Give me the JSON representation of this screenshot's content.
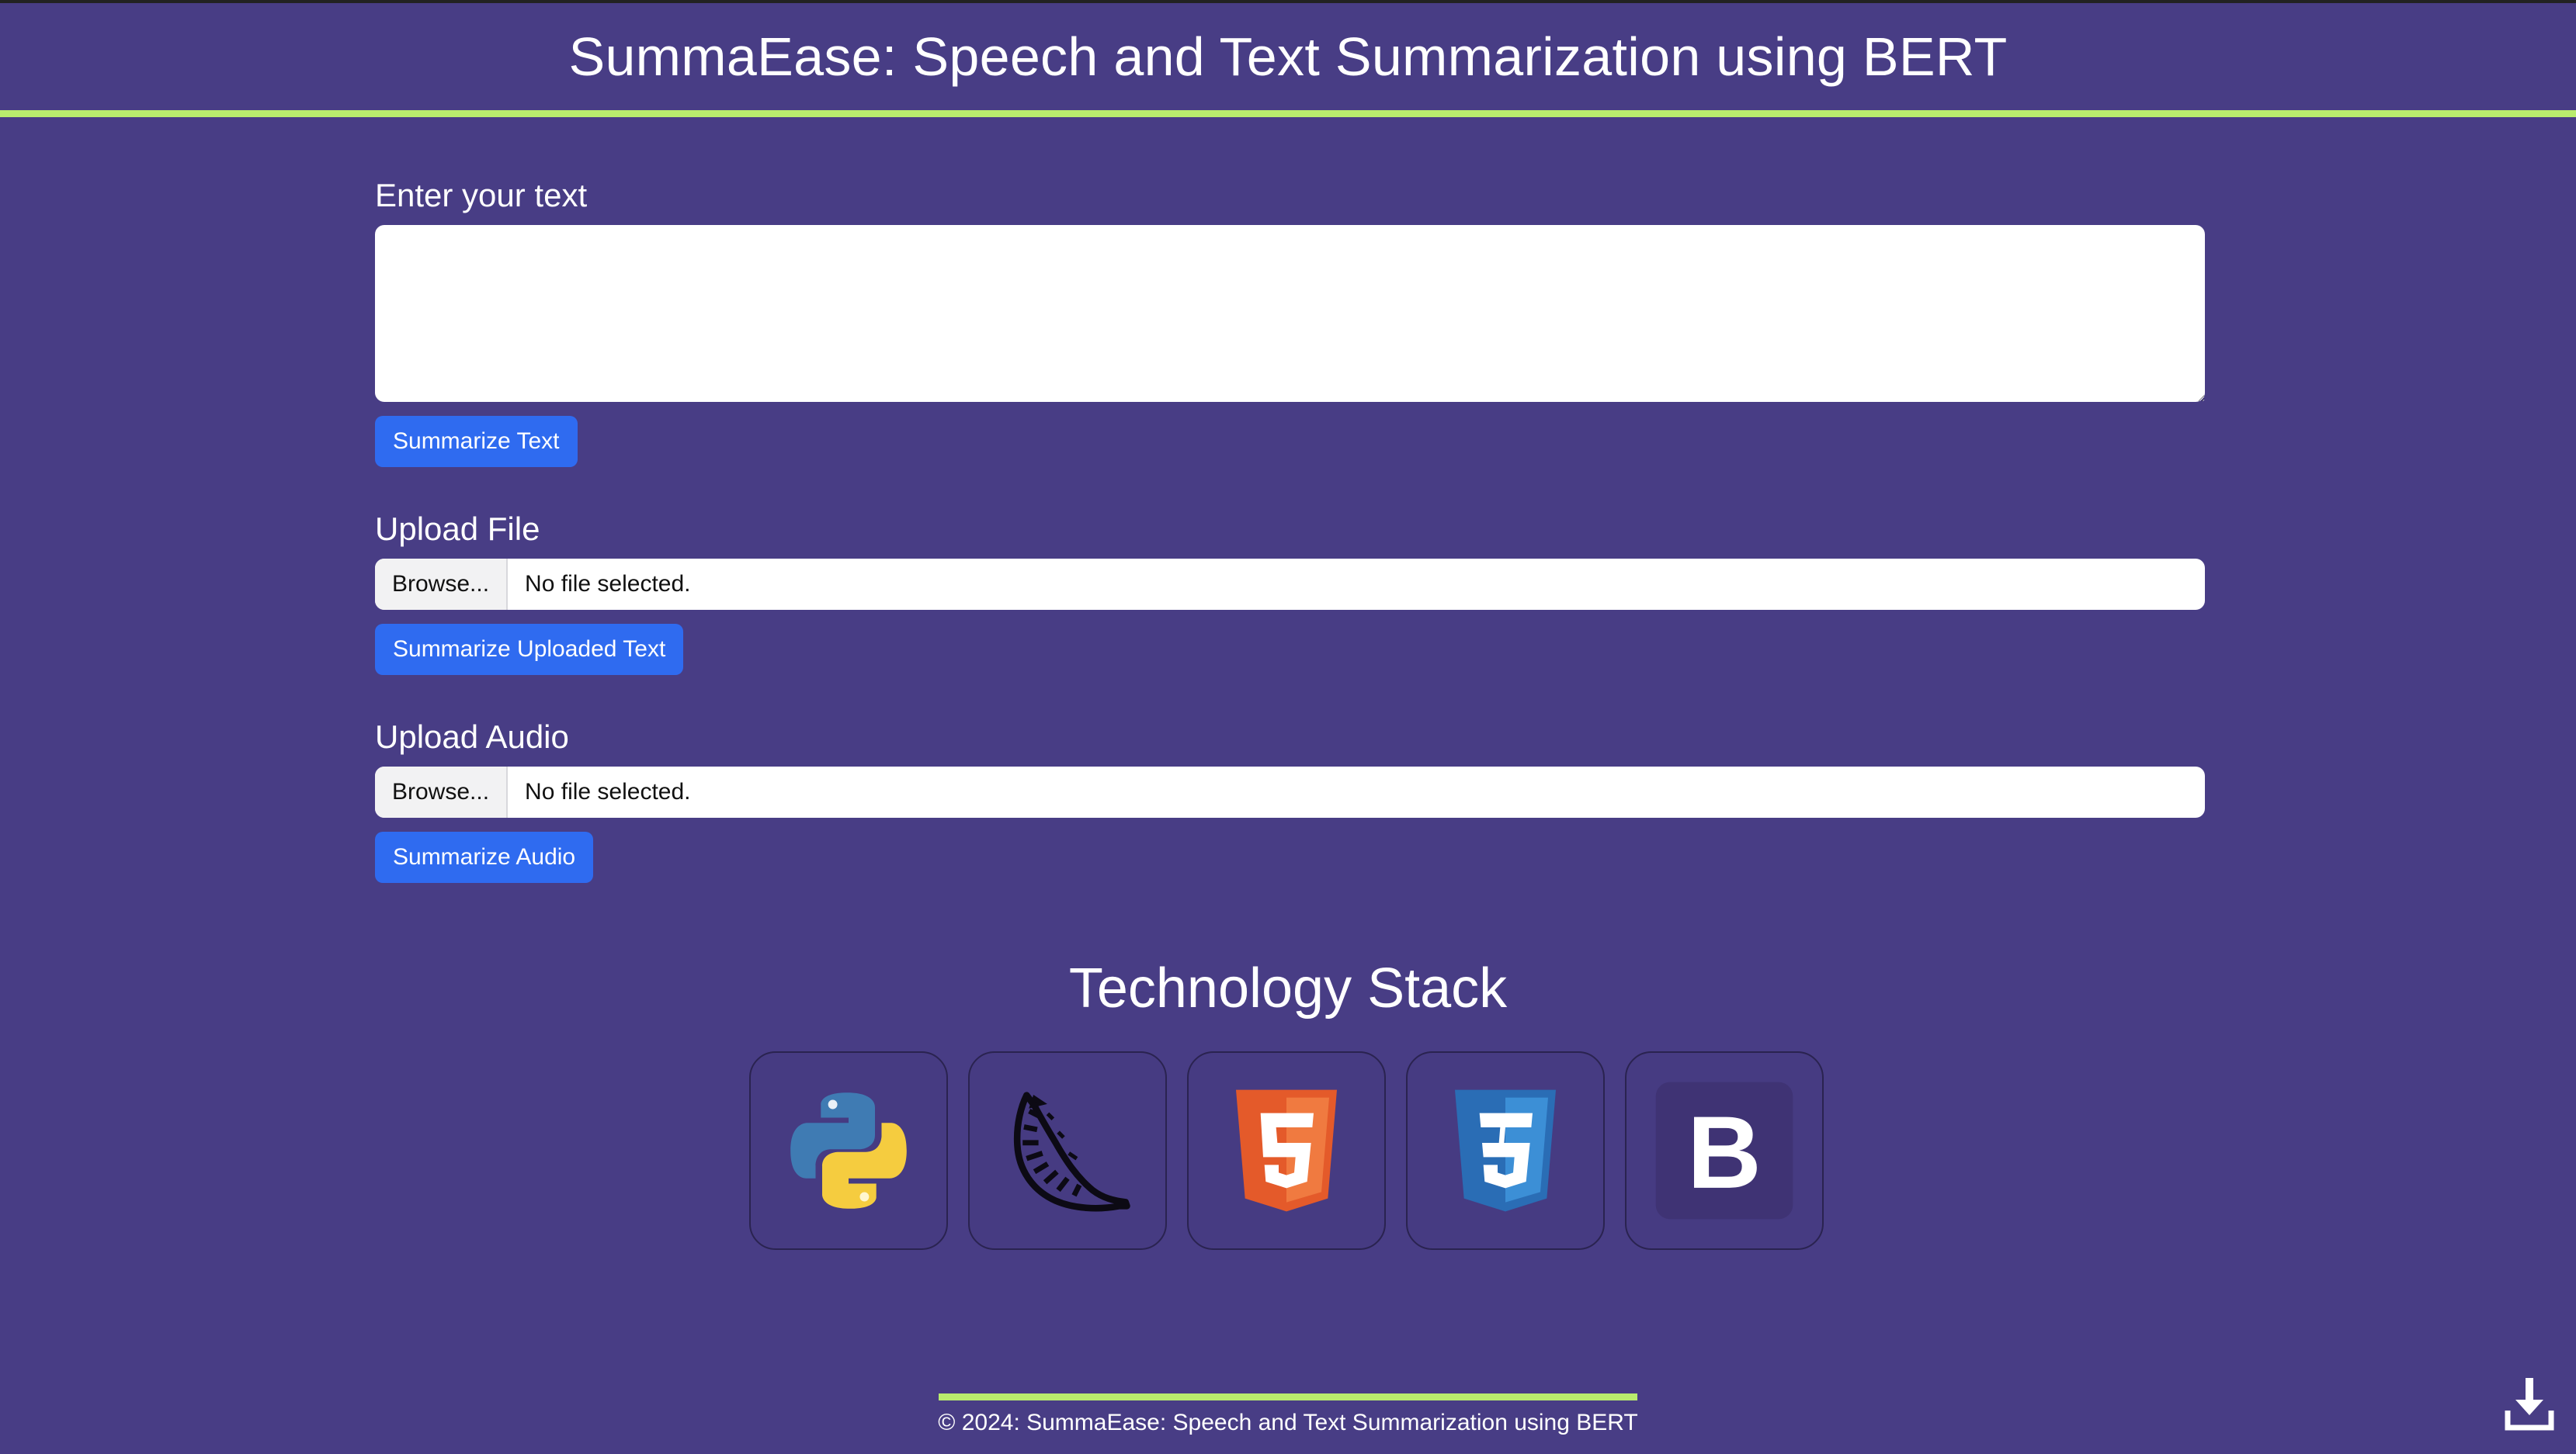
{
  "header": {
    "title": "SummaEase: Speech and Text Summarization using BERT"
  },
  "text_section": {
    "label": "Enter your text",
    "value": "",
    "button_label": "Summarize Text"
  },
  "file_section": {
    "label": "Upload File",
    "browse_label": "Browse...",
    "status": "No file selected.",
    "button_label": "Summarize Uploaded Text"
  },
  "audio_section": {
    "label": "Upload Audio",
    "browse_label": "Browse...",
    "status": "No file selected.",
    "button_label": "Summarize Audio"
  },
  "tech_stack": {
    "title": "Technology Stack",
    "items": [
      {
        "icon": "python-logo-icon"
      },
      {
        "icon": "flask-logo-icon"
      },
      {
        "icon": "html5-logo-icon"
      },
      {
        "icon": "css3-logo-icon"
      },
      {
        "icon": "bootstrap-logo-icon",
        "glyph": "B"
      }
    ]
  },
  "footer": {
    "text": "© 2024: SummaEase: Speech and Text Summarization using BERT"
  },
  "floating": {
    "icon": "download-icon"
  },
  "colors": {
    "background": "#483d85",
    "accent_line": "#b9ec6d",
    "button": "#2f6bf0"
  }
}
